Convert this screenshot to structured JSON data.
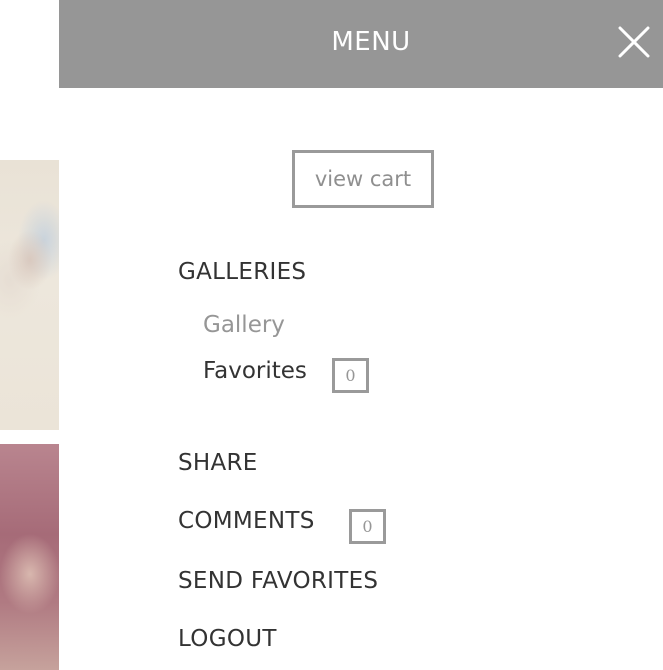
{
  "menu": {
    "title": "MENU",
    "close_icon": "close-icon",
    "view_cart_label": "view cart",
    "galleries_label": "GALLERIES",
    "gallery_items": [
      {
        "label": "Gallery"
      },
      {
        "label": "Favorites",
        "count": "0"
      }
    ],
    "share_label": "SHARE",
    "comments_label": "COMMENTS",
    "comments_count": "0",
    "send_favorites_label": "SEND FAVORITES",
    "logout_label": "LOGOUT"
  },
  "colors": {
    "header_bg": "#969696",
    "header_text": "#ffffff",
    "primary_text": "#333333",
    "muted_text": "#969696",
    "border": "#9a9a9a"
  }
}
